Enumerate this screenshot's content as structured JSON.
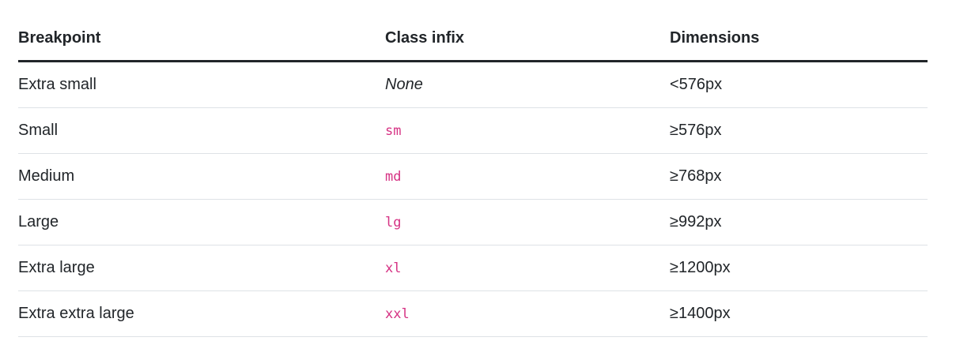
{
  "table": {
    "headers": [
      "Breakpoint",
      "Class infix",
      "Dimensions"
    ],
    "rows": [
      {
        "breakpoint": "Extra small",
        "infix": "None",
        "infix_is_code": false,
        "dimensions": "<576px"
      },
      {
        "breakpoint": "Small",
        "infix": "sm",
        "infix_is_code": true,
        "dimensions": "≥576px"
      },
      {
        "breakpoint": "Medium",
        "infix": "md",
        "infix_is_code": true,
        "dimensions": "≥768px"
      },
      {
        "breakpoint": "Large",
        "infix": "lg",
        "infix_is_code": true,
        "dimensions": "≥992px"
      },
      {
        "breakpoint": "Extra large",
        "infix": "xl",
        "infix_is_code": true,
        "dimensions": "≥1200px"
      },
      {
        "breakpoint": "Extra extra large",
        "infix": "xxl",
        "infix_is_code": true,
        "dimensions": "≥1400px"
      }
    ]
  },
  "colors": {
    "text": "#212529",
    "code": "#d63384",
    "row_border": "#dee2e6",
    "header_border": "#212529"
  }
}
